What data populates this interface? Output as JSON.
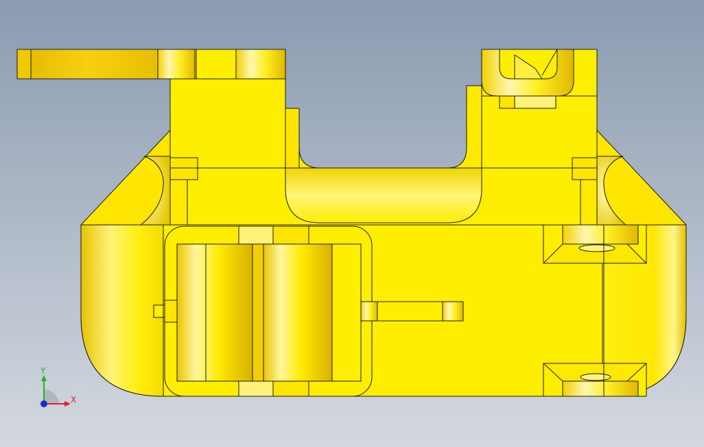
{
  "viewport": {
    "background_top": "#8a9bb0",
    "background_bottom": "#d4d8df"
  },
  "model": {
    "base_color": "#ffee00",
    "highlight_color": "#fffba0",
    "shadow_color": "#d9b400",
    "edge_color": "#1a1a1a"
  },
  "triad": {
    "y_label": "Y",
    "x_label": "X",
    "y_color": "#1db51d",
    "x_color": "#e02020",
    "origin_color": "#1030d0"
  }
}
